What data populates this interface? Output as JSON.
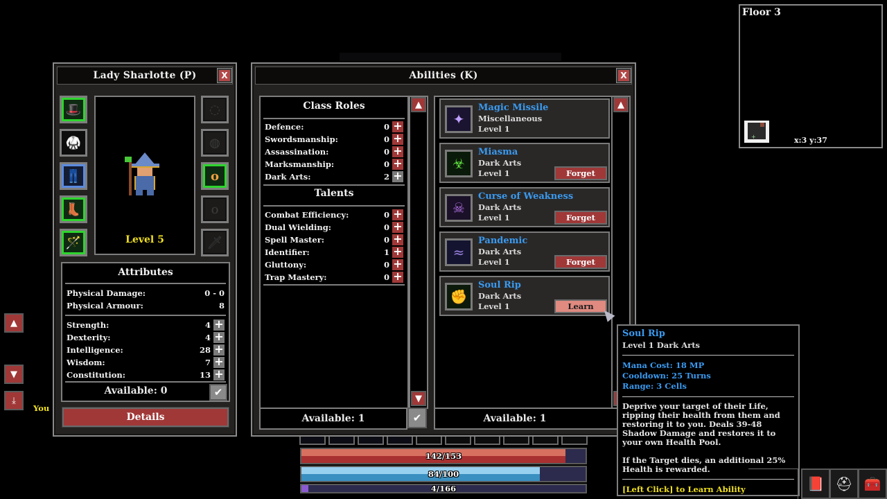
{
  "character_panel": {
    "title": "Lady Sharlotte (P)",
    "close_label": "X",
    "level_label": "Level 5",
    "left_slots": [
      {
        "name": "head-slot",
        "icon": "wizard-hat-icon",
        "glyph": "🎩",
        "state": "green"
      },
      {
        "name": "chest-slot",
        "icon": "robe-armor-icon",
        "glyph": "🥋",
        "state": "empty-border"
      },
      {
        "name": "legs-slot",
        "icon": "pants-icon",
        "glyph": "👖",
        "state": "blue"
      },
      {
        "name": "feet-slot",
        "icon": "boots-icon",
        "glyph": "👢",
        "state": "green"
      },
      {
        "name": "weapon-slot",
        "icon": "staff-icon",
        "glyph": "🪄",
        "state": "green"
      }
    ],
    "right_slots": [
      {
        "name": "amulet-slot",
        "icon": "amulet-icon",
        "glyph": "◌",
        "state": "dark"
      },
      {
        "name": "belt-slot",
        "icon": "belt-icon",
        "glyph": "◍",
        "state": "dark"
      },
      {
        "name": "ring-slot-1",
        "icon": "ring-icon",
        "glyph": "o",
        "state": "green"
      },
      {
        "name": "ring-slot-2",
        "icon": "ring-icon",
        "glyph": "o",
        "state": "dark"
      },
      {
        "name": "offhand-slot",
        "icon": "sword-icon",
        "glyph": "🗡",
        "state": "dark"
      }
    ],
    "attributes_title": "Attributes",
    "derived": [
      {
        "label": "Physical Damage:",
        "value": "0 - 0"
      },
      {
        "label": "Physical Armour:",
        "value": "8"
      }
    ],
    "stats": [
      {
        "label": "Strength:",
        "value": "4"
      },
      {
        "label": "Dexterity:",
        "value": "4"
      },
      {
        "label": "Intelligence:",
        "value": "28"
      },
      {
        "label": "Wisdom:",
        "value": "7"
      },
      {
        "label": "Constitution:",
        "value": "13"
      }
    ],
    "available_label": "Available: 0",
    "details_label": "Details"
  },
  "abilities_panel": {
    "title": "Abilities (K)",
    "close_label": "X",
    "class_roles_title": "Class Roles",
    "class_roles": [
      {
        "label": "Defence:",
        "value": "0",
        "plus": "red"
      },
      {
        "label": "Swordsmanship:",
        "value": "0",
        "plus": "red"
      },
      {
        "label": "Assassination:",
        "value": "0",
        "plus": "red"
      },
      {
        "label": "Marksmanship:",
        "value": "0",
        "plus": "red"
      },
      {
        "label": "Dark Arts:",
        "value": "2",
        "plus": "grey"
      }
    ],
    "talents_title": "Talents",
    "talents": [
      {
        "label": "Combat Efficiency:",
        "value": "0"
      },
      {
        "label": "Dual Wielding:",
        "value": "0"
      },
      {
        "label": "Spell Master:",
        "value": "0"
      },
      {
        "label": "Identifier:",
        "value": "1"
      },
      {
        "label": "Gluttony:",
        "value": "0"
      },
      {
        "label": "Trap Mastery:",
        "value": "0"
      }
    ],
    "roles_available_label": "Available: 1",
    "abilities_available_label": "Available: 1",
    "abilities": [
      {
        "name": "Magic Missile",
        "category": "Miscellaneous",
        "level": "Level 1",
        "icon": "magic-missile-icon",
        "glyph": "✦",
        "action": ""
      },
      {
        "name": "Miasma",
        "category": "Dark Arts",
        "level": "Level 1",
        "icon": "miasma-icon",
        "glyph": "☣",
        "action": "Forget"
      },
      {
        "name": "Curse of Weakness",
        "category": "Dark Arts",
        "level": "Level 1",
        "icon": "curse-skull-icon",
        "glyph": "☠",
        "action": "Forget"
      },
      {
        "name": "Pandemic",
        "category": "Dark Arts",
        "level": "Level 1",
        "icon": "pandemic-icon",
        "glyph": "≈",
        "action": "Forget"
      },
      {
        "name": "Soul Rip",
        "category": "Dark Arts",
        "level": "Level 1",
        "icon": "soul-rip-icon",
        "glyph": "✊",
        "action": "Learn"
      }
    ]
  },
  "tooltip": {
    "name": "Soul Rip",
    "subtitle": "Level 1 Dark Arts",
    "mana_cost": "Mana Cost: 18 MP",
    "cooldown": "Cooldown: 25 Turns",
    "range": "Range: 3 Cells",
    "description": "Deprive your target of their Life, ripping their health from them and restoring it to you. Deals 39-48 Shadow Damage and restores it to your own Health Pool.",
    "bonus": "If the Target dies, an additional 25% Health is rewarded.",
    "hint": "[Left Click] to Learn Ability"
  },
  "minimap": {
    "floor_label": "Floor 3",
    "coords": "x:3 y:37"
  },
  "bars": {
    "health": {
      "text": "142/153",
      "current": 142,
      "max": 153,
      "color_top": "#d87060",
      "color_bottom": "#a83030"
    },
    "mana": {
      "text": "84/100",
      "current": 84,
      "max": 100,
      "color_top": "#98d0f0",
      "color_bottom": "#3a90c0"
    },
    "experience": {
      "text": "4/166",
      "current": 4,
      "max": 166,
      "color": "#8a5ad0"
    }
  },
  "chat": {
    "you_label": "You"
  },
  "side_buttons": {
    "scroll_up": "▲",
    "scroll_down": "▼",
    "scroll_bottom": "⤓"
  },
  "menu_buttons": [
    {
      "name": "spellbook-button",
      "icon": "spellbook-icon",
      "glyph": "📕"
    },
    {
      "name": "character-button",
      "icon": "helmet-icon",
      "glyph": "⛑"
    },
    {
      "name": "inventory-button",
      "icon": "chest-icon",
      "glyph": "🧰"
    }
  ]
}
